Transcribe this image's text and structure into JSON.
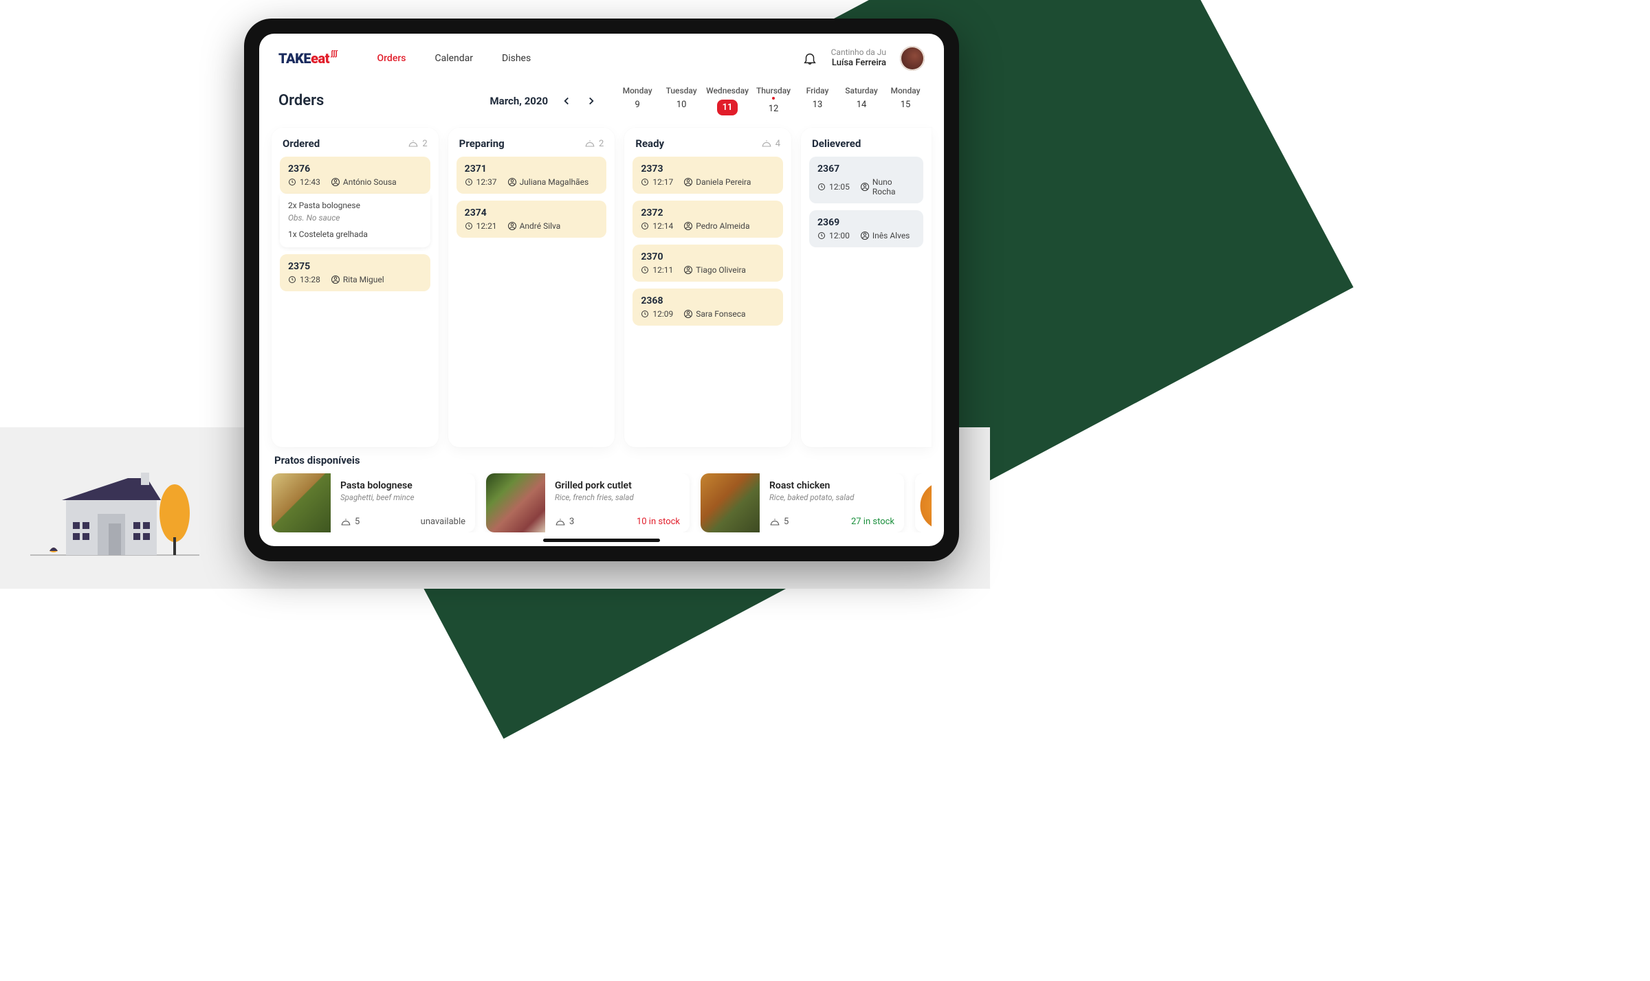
{
  "brand": {
    "take": "TAKE",
    "eat": "eat",
    "steam": "ʃʃʃ"
  },
  "nav": {
    "orders": "Orders",
    "calendar": "Calendar",
    "dishes": "Dishes"
  },
  "user": {
    "restaurant": "Cantinho da Ju",
    "name": "Luísa Ferreira"
  },
  "page": {
    "title": "Orders",
    "month": "March, 2020"
  },
  "days": [
    {
      "label": "Monday",
      "num": "9"
    },
    {
      "label": "Tuesday",
      "num": "10"
    },
    {
      "label": "Wednesday",
      "num": "11",
      "selected": true
    },
    {
      "label": "Thursday",
      "num": "12",
      "marked": true
    },
    {
      "label": "Friday",
      "num": "13"
    },
    {
      "label": "Saturday",
      "num": "14"
    },
    {
      "label": "Monday",
      "num": "15"
    }
  ],
  "columns": {
    "ordered": {
      "title": "Ordered",
      "count": "2",
      "cards": [
        {
          "id": "2376",
          "time": "12:43",
          "customer": "António Sousa",
          "details": {
            "line1": "2x Pasta bolognese",
            "obs": "Obs. No sauce",
            "line2": "1x Costeleta grelhada"
          }
        },
        {
          "id": "2375",
          "time": "13:28",
          "customer": "Rita Miguel"
        }
      ]
    },
    "preparing": {
      "title": "Preparing",
      "count": "2",
      "cards": [
        {
          "id": "2371",
          "time": "12:37",
          "customer": "Juliana Magalhães"
        },
        {
          "id": "2374",
          "time": "12:21",
          "customer": "André Silva"
        }
      ]
    },
    "ready": {
      "title": "Ready",
      "count": "4",
      "cards": [
        {
          "id": "2373",
          "time": "12:17",
          "customer": "Daniela Pereira"
        },
        {
          "id": "2372",
          "time": "12:14",
          "customer": "Pedro Almeida"
        },
        {
          "id": "2370",
          "time": "12:11",
          "customer": "Tiago Oliveira"
        },
        {
          "id": "2368",
          "time": "12:09",
          "customer": "Sara Fonseca"
        }
      ]
    },
    "delivered": {
      "title": "Delievered",
      "cards": [
        {
          "id": "2367",
          "time": "12:05",
          "customer": "Nuno Rocha"
        },
        {
          "id": "2369",
          "time": "12:00",
          "customer": "Inês Alves"
        }
      ]
    }
  },
  "dishes": {
    "panelTitle": "Pratos disponíveis",
    "items": [
      {
        "name": "Pasta bolognese",
        "sub": "Spaghetti, beef mince",
        "portions": "5",
        "stock": "unavailable",
        "stockClass": "stock-unavail",
        "img": "img-pasta"
      },
      {
        "name": "Grilled pork cutlet",
        "sub": "Rice, french fries, salad",
        "portions": "3",
        "stock": "10 in stock",
        "stockClass": "stock-low",
        "img": "img-pork"
      },
      {
        "name": "Roast chicken",
        "sub": "Rice, baked potato, salad",
        "portions": "5",
        "stock": "27 in stock",
        "stockClass": "stock-ok",
        "img": "img-chicken"
      }
    ]
  }
}
